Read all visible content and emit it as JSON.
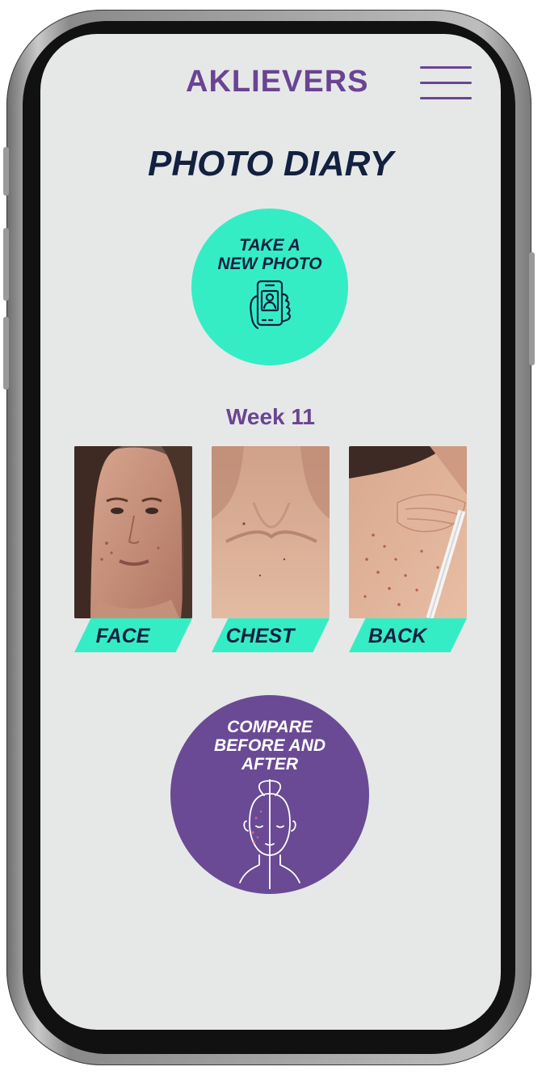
{
  "header": {
    "logo_text": "AKLIEVERS",
    "menu_icon": "hamburger-icon"
  },
  "page": {
    "title": "PHOTO DIARY"
  },
  "take_photo": {
    "line1": "TAKE A",
    "line2": "NEW PHOTO",
    "icon": "phone-selfie-icon"
  },
  "week_label": "Week 11",
  "photos": [
    {
      "label": "FACE"
    },
    {
      "label": "CHEST"
    },
    {
      "label": "BACK"
    }
  ],
  "compare": {
    "line1": "COMPARE",
    "line2": "BEFORE AND",
    "line3": "AFTER",
    "icon": "face-split-icon"
  },
  "colors": {
    "accent_teal": "#35edc5",
    "brand_purple": "#6a4492",
    "navy": "#13203f",
    "screen_bg": "#e6e8e8"
  }
}
